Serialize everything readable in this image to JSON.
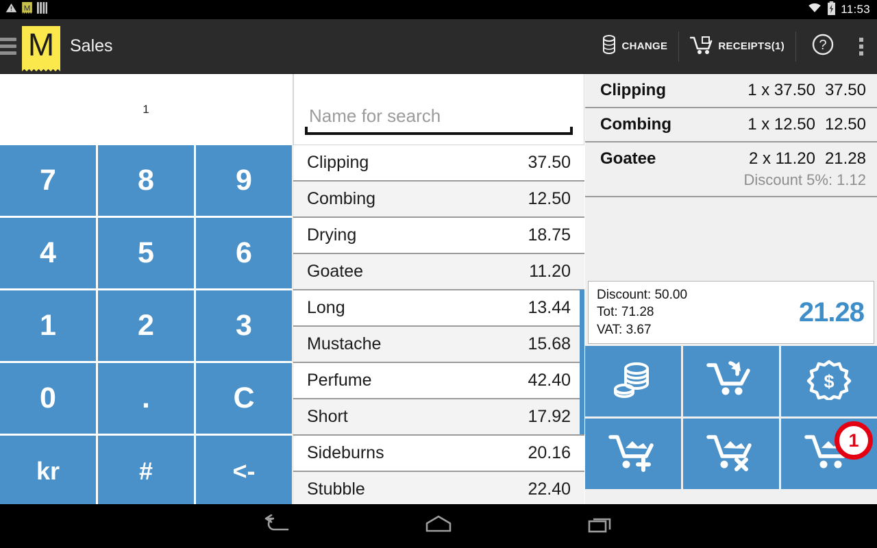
{
  "status_bar": {
    "icons": [
      "warning-triangle-icon",
      "app-receipt-icon",
      "bars-icon"
    ],
    "wifi_icon": "wifi-icon",
    "battery_icon": "battery-charging-icon",
    "clock": "11:53"
  },
  "action_bar": {
    "menu_icon": "hamburger-menu-icon",
    "logo_letter": "M",
    "title": "Sales",
    "change_label": "CHANGE",
    "change_icon": "coins-icon",
    "receipts_label": "RECEIPTS(1)",
    "receipts_icon": "cart-receipt-icon",
    "help_icon": "help-circle-icon",
    "overflow_icon": "overflow-menu-icon"
  },
  "keypad": {
    "display_value": "1",
    "keys": [
      "7",
      "8",
      "9",
      "4",
      "5",
      "6",
      "1",
      "2",
      "3",
      "0",
      ".",
      "C",
      "kr",
      "#",
      "<-"
    ]
  },
  "search": {
    "placeholder": "Name for search",
    "value": ""
  },
  "products": [
    {
      "name": "Clipping",
      "price": "37.50"
    },
    {
      "name": "Combing",
      "price": "12.50"
    },
    {
      "name": "Drying",
      "price": "18.75"
    },
    {
      "name": "Goatee",
      "price": "11.20"
    },
    {
      "name": "Long",
      "price": "13.44"
    },
    {
      "name": "Mustache",
      "price": "15.68"
    },
    {
      "name": "Perfume",
      "price": "42.40"
    },
    {
      "name": "Short",
      "price": "17.92"
    },
    {
      "name": "Sideburns",
      "price": "20.16"
    },
    {
      "name": "Stubble",
      "price": "22.40"
    }
  ],
  "cart": {
    "lines": [
      {
        "name": "Clipping",
        "qty_price": "1 x 37.50",
        "amount": "37.50",
        "discount": ""
      },
      {
        "name": "Combing",
        "qty_price": "1 x 12.50",
        "amount": "12.50",
        "discount": ""
      },
      {
        "name": "Goatee",
        "qty_price": "2 x 11.20",
        "amount": "21.28",
        "discount": "Discount 5%: 1.12"
      }
    ],
    "totals": {
      "discount": "Discount: 50.00",
      "total": "Tot: 71.28",
      "vat": "VAT: 3.67",
      "grand_total": "21.28"
    },
    "actions": [
      {
        "name": "cash-payment-button",
        "icon": "coins-stack-icon"
      },
      {
        "name": "refund-button",
        "icon": "cart-return-icon"
      },
      {
        "name": "price-discount-button",
        "icon": "price-tag-dollar-icon"
      },
      {
        "name": "save-cart-button",
        "icon": "cart-add-icon"
      },
      {
        "name": "clear-cart-button",
        "icon": "cart-remove-icon"
      },
      {
        "name": "parked-carts-button",
        "icon": "cart-parked-icon",
        "badge": "1"
      }
    ]
  },
  "nav_bar": {
    "back_icon": "back-icon",
    "home_icon": "home-icon",
    "recents_icon": "recents-icon"
  },
  "colors": {
    "accent_blue": "#4a91c9",
    "logo_yellow": "#fbe84d",
    "badge_red": "#e40012",
    "action_bar": "#2b2b2b"
  }
}
